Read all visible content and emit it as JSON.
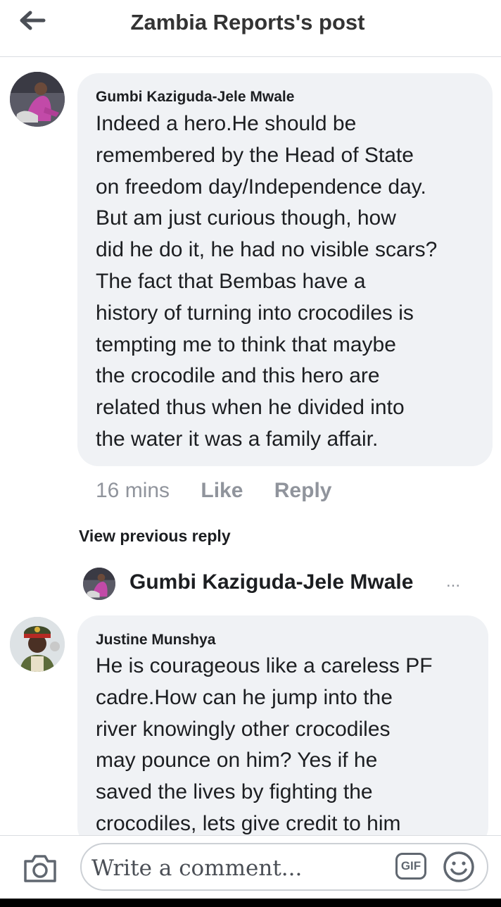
{
  "header": {
    "title": "Zambia Reports's post",
    "back_icon": "arrow-left-icon"
  },
  "comments": [
    {
      "author": "Gumbi Kaziguda-Jele Mwale",
      "text": "Indeed a hero.He should be\nremembered by the Head of State\non freedom day/Independence day.\nBut am just curious though, how\ndid he do it, he had no visible scars?\nThe fact that Bembas have a\nhistory of turning into crocodiles is\ntempting me to think that maybe\nthe crocodile and this hero are\nrelated thus when he divided into\nthe water it was a family affair.",
      "time": "16 mins",
      "like_label": "Like",
      "reply_label": "Reply"
    },
    {
      "author": "Justine Munshya",
      "text": "He is courageous like a careless PF\ncadre.How can he jump into the\nriver knowingly other crocodiles\nmay pounce on him? Yes if he\nsaved the lives by fighting the\ncrocodiles, lets give credit to him"
    }
  ],
  "replies": {
    "view_previous_label": "View previous reply",
    "latest_reply_author": "Gumbi Kaziguda-Jele Mwale",
    "ellipsis": "..."
  },
  "composer": {
    "placeholder": "Write a comment...",
    "gif_label": "GIF",
    "camera_icon": "camera-icon",
    "emoji_icon": "smiley-icon"
  },
  "colors": {
    "bubble_bg": "#f0f2f5",
    "meta_gray": "#90949c",
    "text": "#1c1e21"
  }
}
